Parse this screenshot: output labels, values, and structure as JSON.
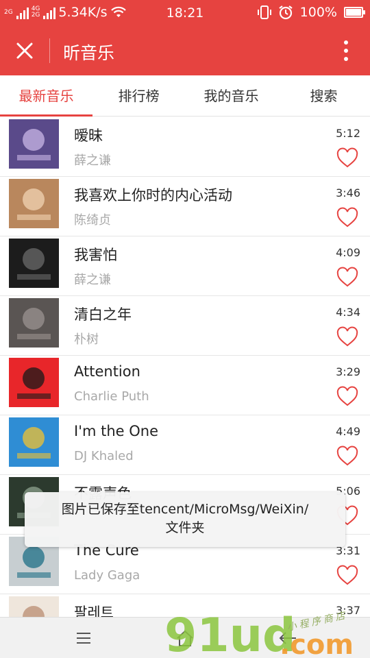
{
  "status_bar": {
    "net_top": "2G",
    "net_mid": "4G",
    "net_bottom": "2G",
    "speed": "5.34K/s",
    "time": "18:21",
    "battery": "100%",
    "battery_level": 1.0
  },
  "app_bar": {
    "title": "昕音乐"
  },
  "tabs": [
    {
      "label": "最新音乐",
      "active": true
    },
    {
      "label": "排行榜",
      "active": false
    },
    {
      "label": "我的音乐",
      "active": false
    },
    {
      "label": "搜索",
      "active": false
    }
  ],
  "songs": [
    {
      "title": "暧昧",
      "singer": "薛之谦",
      "duration": "5:12",
      "cover_color": "#5a4a8a",
      "cover_accent": "#c9b7e6"
    },
    {
      "title": "我喜欢上你时的内心活动",
      "singer": "陈绮贞",
      "duration": "3:46",
      "cover_color": "#b9875d",
      "cover_accent": "#f2d3b3"
    },
    {
      "title": "我害怕",
      "singer": "薛之谦",
      "duration": "4:09",
      "cover_color": "#1c1c1c",
      "cover_accent": "#6a6a6a"
    },
    {
      "title": "清白之年",
      "singer": "朴树",
      "duration": "4:34",
      "cover_color": "#5a5553",
      "cover_accent": "#9b9390"
    },
    {
      "title": "Attention",
      "singer": "Charlie Puth",
      "duration": "3:29",
      "cover_color": "#e8262a",
      "cover_accent": "#1a1a1a"
    },
    {
      "title": "I'm the One",
      "singer": "DJ Khaled",
      "duration": "4:49",
      "cover_color": "#2f8dd4",
      "cover_accent": "#f2c230"
    },
    {
      "title": "不露声色",
      "singer": "",
      "duration": "5:06",
      "cover_color": "#2c3a2e",
      "cover_accent": "#8ea38f"
    },
    {
      "title": "The Cure",
      "singer": "Lady Gaga",
      "duration": "3:31",
      "cover_color": "#c7ced1",
      "cover_accent": "#1e6f86"
    },
    {
      "title": "팔레트",
      "singer": "",
      "duration": "3:37",
      "cover_color": "#efe6dc",
      "cover_accent": "#b98c72"
    }
  ],
  "toast": {
    "line1": "图片已保存至tencent/MicroMsg/WeiXin/",
    "line2": "文件夹"
  },
  "watermark": {
    "logo": "91ud.com",
    "stamp": "小程序商店"
  },
  "colors": {
    "brand_red": "#e64340",
    "heart_red": "#e64340"
  }
}
